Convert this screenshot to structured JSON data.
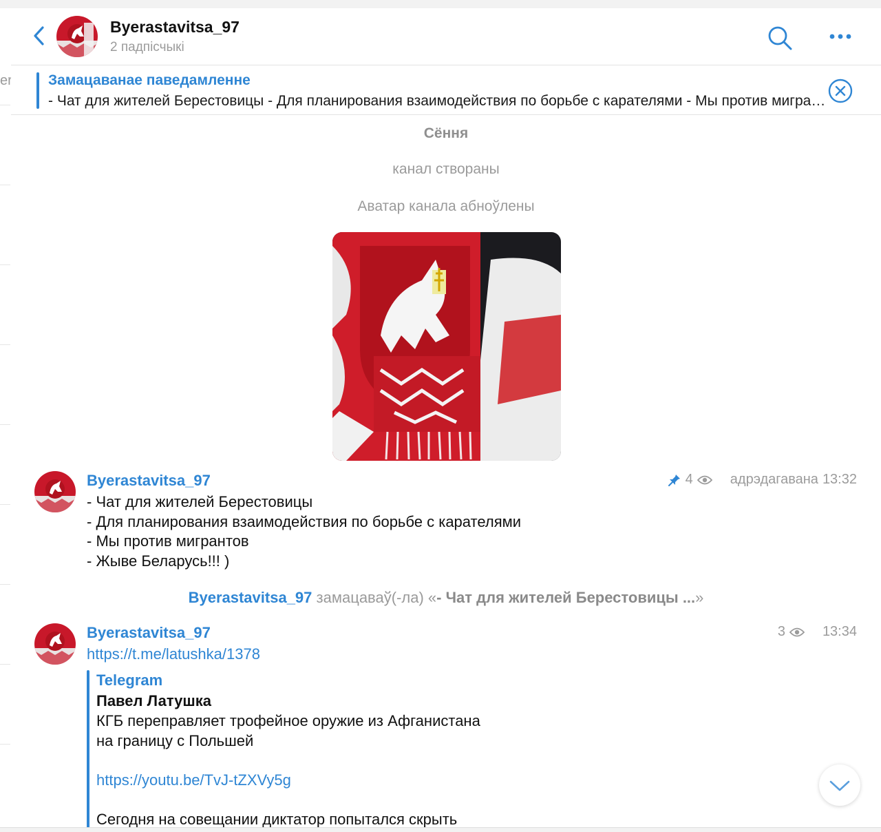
{
  "left_strip": {
    "fragments": [
      "er"
    ]
  },
  "header": {
    "title": "Byerastavitsa_97",
    "subtitle": "2 падпісчыкі"
  },
  "pinned": {
    "title": "Замацаванае паведамленне",
    "text": "- Чат для жителей Берестовицы - Для планирования взаимодействия по борьбе с карателями  - Мы против мигрантов - Жыве Беларусь!!! )"
  },
  "service": {
    "date": "Сёння",
    "created": "канал створаны",
    "avatar_reset": "Аватар канала абноўлены"
  },
  "messages": [
    {
      "author": "Byerastavitsa_97",
      "views": "4",
      "edited": "адрэдагавана",
      "time": "13:32",
      "pinned": true,
      "lines": [
        "- Чат для жителей Берестовицы",
        "- Для планирования взаимодействия по борьбе с карателями",
        "- Мы против мигрантов",
        "- Жыве Беларусь!!! )"
      ]
    },
    {
      "author": "Byerastavitsa_97",
      "views": "3",
      "time": "13:34",
      "link": "https://t.me/latushka/1378",
      "preview": {
        "site": "Telegram",
        "title": "Павел Латушка",
        "lines": [
          "КГБ переправляет трофейное оружие из Афганистана",
          "на границу с Польшей",
          "",
          "https://youtu.be/TvJ-tZXVy5g",
          "",
          "Сегодня на совещании диктатор попытался скрыть"
        ]
      }
    }
  ],
  "pin_notice": {
    "who": "Byerastavitsa_97",
    "action": "замацаваў(-ла)",
    "quote_open": "«",
    "quote": "- Чат для жителей Берестовицы ...",
    "quote_close": "»"
  },
  "colors": {
    "accent": "#2f86d4",
    "muted": "#9b9b9b",
    "flag_red": "#d0202a"
  },
  "icons": [
    "back-arrow-icon",
    "search-icon",
    "more-icon",
    "close-circle-icon",
    "pin-icon",
    "eye-icon",
    "chevron-down-icon"
  ]
}
